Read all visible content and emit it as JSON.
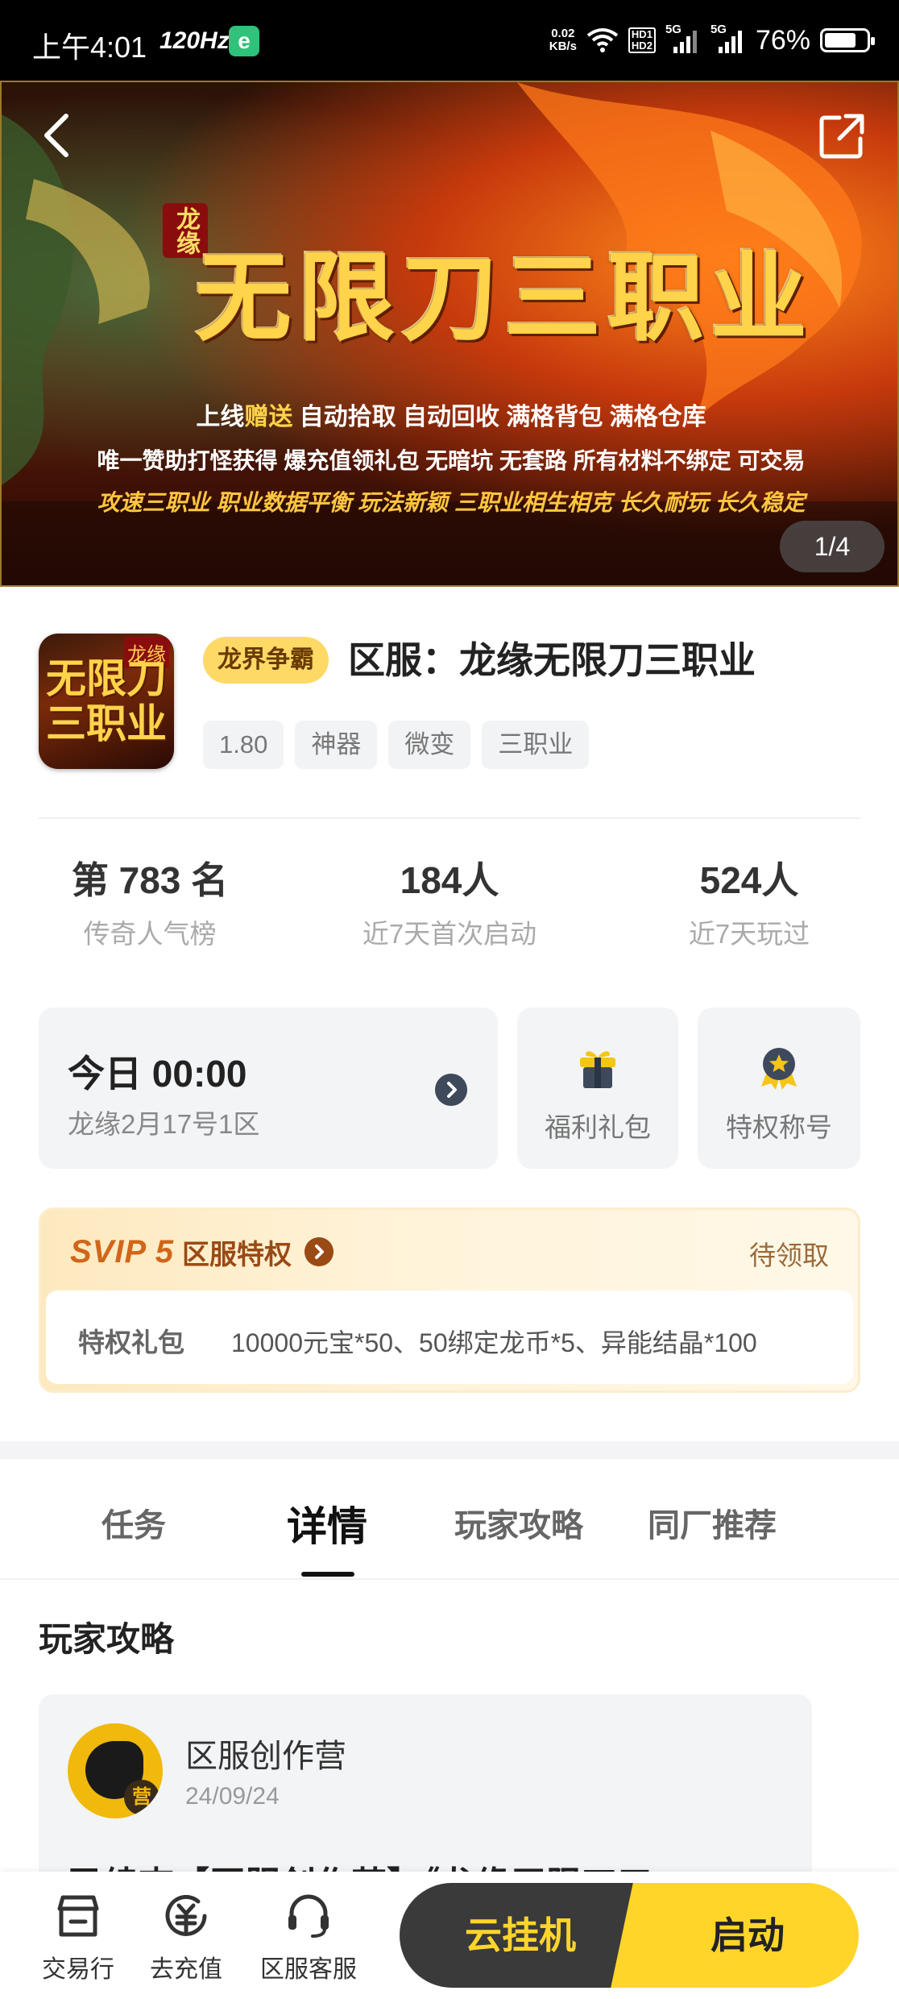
{
  "status_bar": {
    "time": "上午4:01",
    "refresh_rate": "120Hz",
    "app_badge": "e",
    "net_speed": "0.02",
    "net_speed_unit": "KB/s",
    "hd1": "HD1",
    "hd2": "HD2",
    "sim1": "5G",
    "sim2": "5G",
    "battery_percent": "76%",
    "battery_level": 0.76
  },
  "banner": {
    "small_logo": "龙缘",
    "title": "无限刀三职业",
    "line1_prefix": "上线",
    "line1_highlight": "赠送",
    "line1_rest": " 自动拾取 自动回收 满格背包 满格仓库",
    "line2": "唯一赞助打怪获得 爆充值领礼包 无暗坑 无套路 所有材料不绑定 可交易",
    "line3": "攻速三职业 职业数据平衡 玩法新颖    三职业相生相克 长久耐玩 长久稳定",
    "counter": "1/4"
  },
  "game": {
    "icon_badge": "龙缘",
    "icon_text": "无限刀三职业",
    "category": "龙界争霸",
    "title": "区服：龙缘无限刀三职业",
    "tags": [
      "1.80",
      "神器",
      "微变",
      "三职业"
    ]
  },
  "stats": [
    {
      "value": "第 783 名",
      "label": "传奇人气榜"
    },
    {
      "value": "184人",
      "label": "近7天首次启动"
    },
    {
      "value": "524人",
      "label": "近7天玩过"
    }
  ],
  "server_card": {
    "time": "今日 00:00",
    "name": "龙缘2月17号1区"
  },
  "gift_card": {
    "label": "福利礼包"
  },
  "title_card": {
    "label": "特权称号"
  },
  "svip": {
    "logo": "SVIP 5",
    "name": "区服特权",
    "status": "待领取",
    "key": "特权礼包",
    "desc": "10000元宝*50、50绑定龙币*5、异能结晶*100"
  },
  "tabs": [
    {
      "label": "任务"
    },
    {
      "label": "详情"
    },
    {
      "label": "玩家攻略"
    },
    {
      "label": "同厂推荐"
    }
  ],
  "section": {
    "title_a": "玩家",
    "title_b": "攻略"
  },
  "post": {
    "avatar_seal": "营",
    "author": "区服创作营",
    "date": "24/09/24",
    "text": "已续查【区服创作营】《龙缘无限刀三"
  },
  "bottom": {
    "items": [
      {
        "label": "交易行"
      },
      {
        "label": "去充值"
      },
      {
        "label": "区服客服"
      }
    ],
    "cloud_button": "云挂机",
    "start_button": "启动"
  },
  "colors": {
    "accent_yellow": "#ffd52a",
    "dark_button": "#3a3a3a",
    "svip_brown": "#9a4a14",
    "svip_orange": "#d0661a"
  }
}
